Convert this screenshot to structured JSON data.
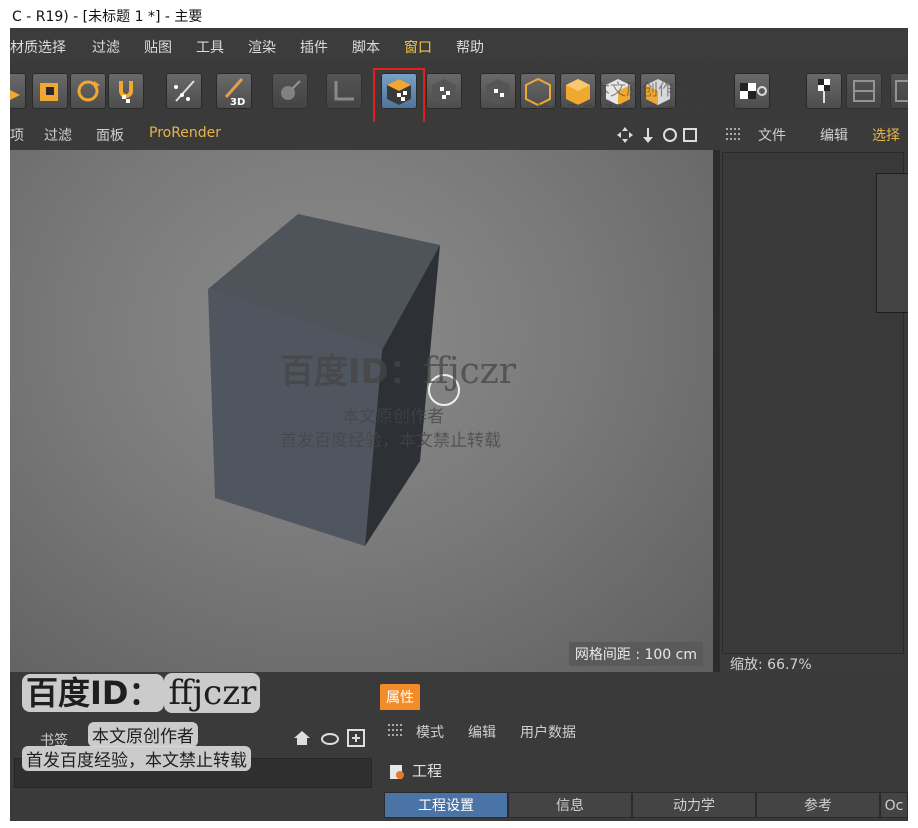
{
  "window": {
    "title": "C - R19) - [未标题 1 *] - 主要"
  },
  "menubar": {
    "items": [
      "材质选择",
      "过滤",
      "贴图",
      "工具",
      "渲染",
      "插件",
      "脚本",
      "窗口",
      "帮助"
    ],
    "active_item": "窗口"
  },
  "toolbar": {
    "icons": [
      "cube-dropdown-icon",
      "rotate-icon",
      "magnet-checker-icon",
      "dots-brush-icon",
      "paint-brush-3d-icon",
      "sculpt-icon",
      "floor-icon",
      "texture-mode-icon",
      "texture-alt-icon",
      "model-mode-icon",
      "points-mode-icon",
      "edges-mode-icon",
      "polygons-mode-icon",
      "uv-mode-icon",
      "checker-gear-icon",
      "pin-icon",
      "layout-icon"
    ],
    "highlighted_icon": "texture-mode-icon",
    "highlight_color": "#e0201e"
  },
  "viewport": {
    "menu": [
      "项",
      "过滤",
      "面板",
      "ProRender"
    ],
    "accent_item": "ProRender",
    "grid_spacing": "网格间距 : 100 cm"
  },
  "right_panel": {
    "menu": [
      "文件",
      "编辑",
      "选择"
    ],
    "accent_item": "选择",
    "zoom": "缩放: 66.7%"
  },
  "attributes": {
    "tab": "属性",
    "menu": [
      "模式",
      "编辑",
      "用户数据"
    ],
    "object": "工程",
    "tabs": [
      "工程设置",
      "信息",
      "动力学",
      "参考",
      "Oc"
    ],
    "active_tab": "工程设置"
  },
  "bottom_left": {
    "tab": "书签"
  },
  "watermark": {
    "brand": "百度ID：",
    "id": "ffjczr",
    "line1": "本文原创作者",
    "line2": "首发百度经验，本文禁止转载"
  }
}
